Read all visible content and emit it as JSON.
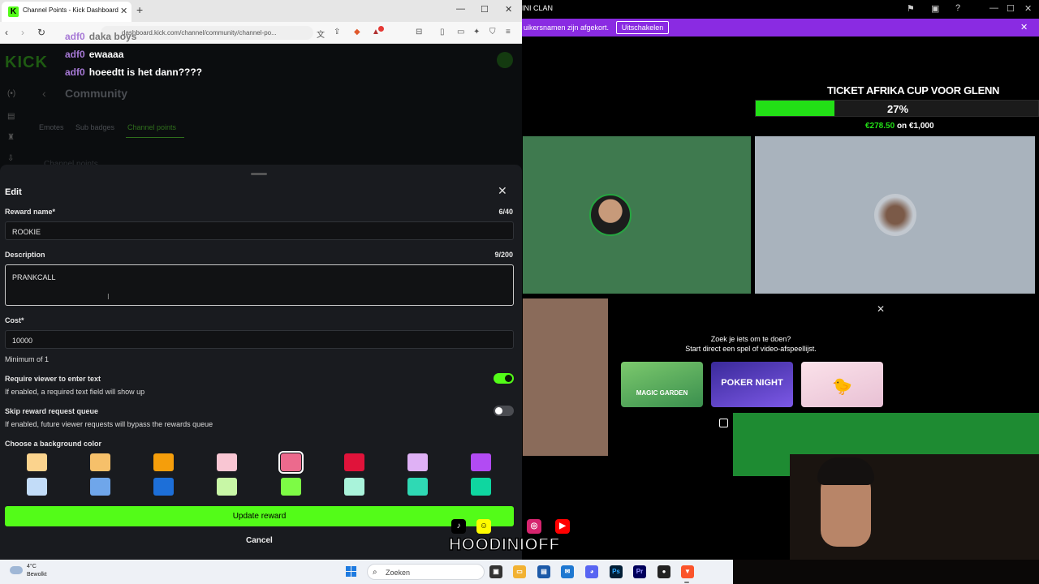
{
  "browser": {
    "tab_title": "Channel Points - Kick Dashboard",
    "tab_favicon": "K",
    "url": "dashboard.kick.com/channel/community/channel-po...",
    "nav": {
      "back_icon": "‹",
      "forward_icon": "›",
      "reload_icon": "↻"
    }
  },
  "dashboard": {
    "logo": "KICK",
    "page_title": "Community",
    "tabs": [
      {
        "label": "Emotes"
      },
      {
        "label": "Sub badges"
      },
      {
        "label": "Channel points"
      }
    ],
    "section_title": "Channel points"
  },
  "chat": [
    {
      "user": "adf0",
      "message": "daka boys"
    },
    {
      "user": "adf0",
      "message": "ewaaaa"
    },
    {
      "user": "adf0",
      "message": "hoeedtt is het dann????"
    }
  ],
  "modal": {
    "title": "Edit",
    "reward_name": {
      "label": "Reward name*",
      "counter": "6/40",
      "value": "ROOKIE"
    },
    "description": {
      "label": "Description",
      "counter": "9/200",
      "value": "PRANKCALL"
    },
    "cost": {
      "label": "Cost*",
      "value": "10000",
      "help": "Minimum of 1"
    },
    "require_text": {
      "label": "Require viewer to enter text",
      "help": "If enabled, a required text field will show up",
      "enabled": true
    },
    "skip_queue": {
      "label": "Skip reward request queue",
      "help": "If enabled, future viewer requests will bypass the rewards queue",
      "enabled": false
    },
    "color_label": "Choose a background color",
    "colors": [
      "#fbd38d",
      "#f6c06a",
      "#f59e0b",
      "#f9c6d3",
      "#ec6a8d",
      "#e0133a",
      "#dfb1f5",
      "#b24bf3",
      "#c2dcf8",
      "#6fa6ea",
      "#1d6fd8",
      "#c8f7a6",
      "#7dfb45",
      "#a9f3da",
      "#2fd9b4",
      "#0fd6a0"
    ],
    "selected_color": "#ec6a8d",
    "update_label": "Update reward",
    "cancel_label": "Cancel"
  },
  "stream": {
    "window_title": "INI CLAN",
    "banner_text": "uikersnamen zijn afgekort.",
    "banner_button": "Uitschakelen",
    "goal": {
      "title": "TICKET AFRIKA CUP VOOR GLENN",
      "percent_label": "27%",
      "progress": 0.28,
      "raised": "€278.50",
      "of_word": "on",
      "target": "€1,000"
    },
    "game_panel": {
      "line1": "Zoek je iets om te doen?",
      "line2": "Start direct een spel of video-afspeellijst.",
      "games": [
        {
          "name": "MAGIC GARDEN",
          "color": "#4aa35a"
        },
        {
          "name": "POKER NIGHT",
          "color": "#5b3fc4"
        },
        {
          "name": "",
          "color": "#f3d9e4"
        }
      ]
    },
    "brand": "HOODINIOFF",
    "socials": [
      {
        "icon": "tiktok-icon",
        "glyph": "♪",
        "color": "#000000"
      },
      {
        "icon": "snapchat-icon",
        "glyph": "👻",
        "color": "#fffc00"
      },
      {
        "icon": "instagram-icon",
        "glyph": "◎",
        "color": "#d6246e"
      },
      {
        "icon": "youtube-icon",
        "glyph": "▶",
        "color": "#ff0000"
      }
    ]
  },
  "taskbar": {
    "temperature": "4°C",
    "weather": "Bewolkt",
    "search_placeholder": "Zoeken"
  },
  "colors": {
    "kick_green": "#53fc18",
    "chat_user": "#a779d6",
    "banner_purple": "#8a2be2",
    "goal_green": "#22e016"
  }
}
